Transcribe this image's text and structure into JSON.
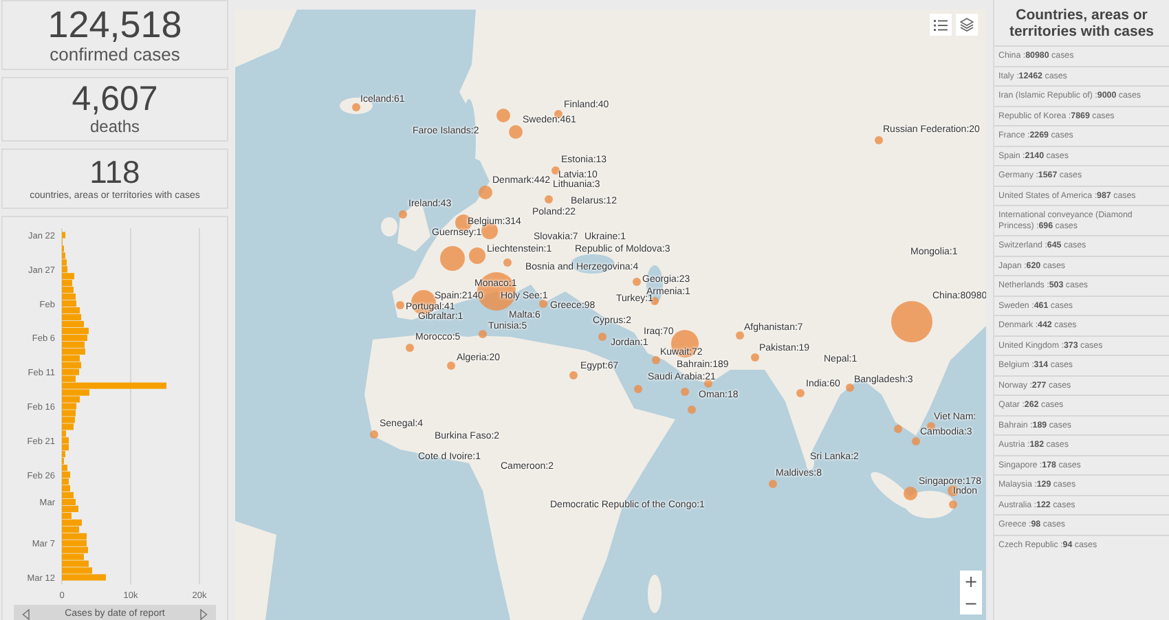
{
  "stats": [
    {
      "value": "124,518",
      "caption": "confirmed cases",
      "kind": "large"
    },
    {
      "value": "4,607",
      "caption": "deaths",
      "kind": "medium"
    },
    {
      "value": "118",
      "caption": "countries, areas or territories with cases",
      "kind": "small"
    }
  ],
  "chart": {
    "chart_data": {
      "type": "bar",
      "orientation": "horizontal",
      "title": "Cases by date of report",
      "categories": [
        "Jan 22",
        null,
        null,
        null,
        null,
        "Jan 27",
        null,
        null,
        null,
        null,
        "Feb",
        null,
        null,
        null,
        null,
        "Feb 6",
        null,
        null,
        null,
        null,
        "Feb 11",
        null,
        null,
        null,
        null,
        "Feb 16",
        null,
        null,
        null,
        null,
        "Feb 21",
        null,
        null,
        null,
        null,
        "Feb 26",
        null,
        null,
        null,
        "Mar",
        null,
        null,
        null,
        null,
        null,
        "Mar 7",
        null,
        null,
        null,
        null,
        "Mar 12"
      ],
      "values": [
        500,
        100,
        300,
        500,
        700,
        800,
        1800,
        1500,
        1700,
        2000,
        2100,
        2600,
        2800,
        3200,
        3900,
        3700,
        3300,
        3400,
        2600,
        2800,
        2500,
        2000,
        15200,
        4000,
        2600,
        2100,
        2000,
        1900,
        1700,
        600,
        1000,
        1000,
        500,
        300,
        800,
        1200,
        1000,
        1200,
        1700,
        2000,
        2400,
        1400,
        2900,
        2500,
        3600,
        3600,
        3800,
        3200,
        3900,
        4400,
        6400
      ],
      "xlim": [
        0,
        20000
      ],
      "xticks": [
        {
          "value": 0,
          "label": "0"
        },
        {
          "value": 10000,
          "label": "10k"
        },
        {
          "value": 20000,
          "label": "20k"
        }
      ]
    }
  },
  "map": {
    "labels": [
      "Iceland:61",
      "Finland:40",
      "Sweden:461",
      "Faroe Islands:2",
      "Russian Federation:20",
      "Estonia:13",
      "Latvia:10",
      "Denmark:442",
      "Lithuania:3",
      "Ireland:43",
      "Belarus:12",
      "Poland:22",
      "Belgium:314",
      "Guernsey:1",
      "Slovakia:7",
      "Ukraine:1",
      "Liechtenstein:1",
      "Republic of Moldova:3",
      "Mongolia:1",
      "Bosnia and Herzegovina:4",
      "Monaco:1",
      "Georgia:23",
      "Armenia:1",
      "Spain:2140",
      "Holy See:1",
      "Turkey:1",
      "China:80980",
      "Portugal:41",
      "Greece:98",
      "Gibraltar:1",
      "Malta:6",
      "Tunisia:5",
      "Cyprus:2",
      "Afghanistan:7",
      "Iraq:70",
      "Morocco:5",
      "Jordan:1",
      "Kuwait:72",
      "Pakistan:19",
      "Algeria:20",
      "Nepal:1",
      "Egypt:67",
      "Bahrain:189",
      "Saudi Arabia:21",
      "India:60",
      "Bangladesh:3",
      "Oman:18",
      "Viet Nam:",
      "Senegal:4",
      "Burkina Faso:2",
      "Cambodia:3",
      "Cote d Ivoire:1",
      "Sri Lanka:2",
      "Cameroon:2",
      "Maldives:8",
      "Singapore:178",
      "Indon",
      "Democratic Republic of the Congo:1"
    ],
    "zoom_in": "+",
    "zoom_out": "−"
  },
  "list": {
    "title": "Countries, areas or territories with cases",
    "items": [
      "China :**80980** cases",
      "Italy :**12462** cases",
      "Iran (Islamic Republic of) :**9000** cases",
      "Republic of Korea :**7869** cases",
      "France :**2269** cases",
      "Spain :**2140** cases",
      "Germany :**1567** cases",
      "United States of America :**987** cases",
      "International conveyance (Diamond Princess) :**696** cases",
      "Switzerland :**645** cases",
      "Japan :**620** cases",
      "Netherlands :**503** cases",
      "Sweden :**461** cases",
      "Denmark :**442** cases",
      "United Kingdom :**373** cases",
      "Belgium :**314** cases",
      "Norway :**277** cases",
      "Qatar :**262** cases",
      "Bahrain :**189** cases",
      "Austria :**182** cases",
      "Singapore :**178** cases",
      "Malaysia :**129** cases",
      "Australia :**122** cases",
      "Greece :**98** cases",
      "Czech Republic :**94** cases"
    ]
  }
}
